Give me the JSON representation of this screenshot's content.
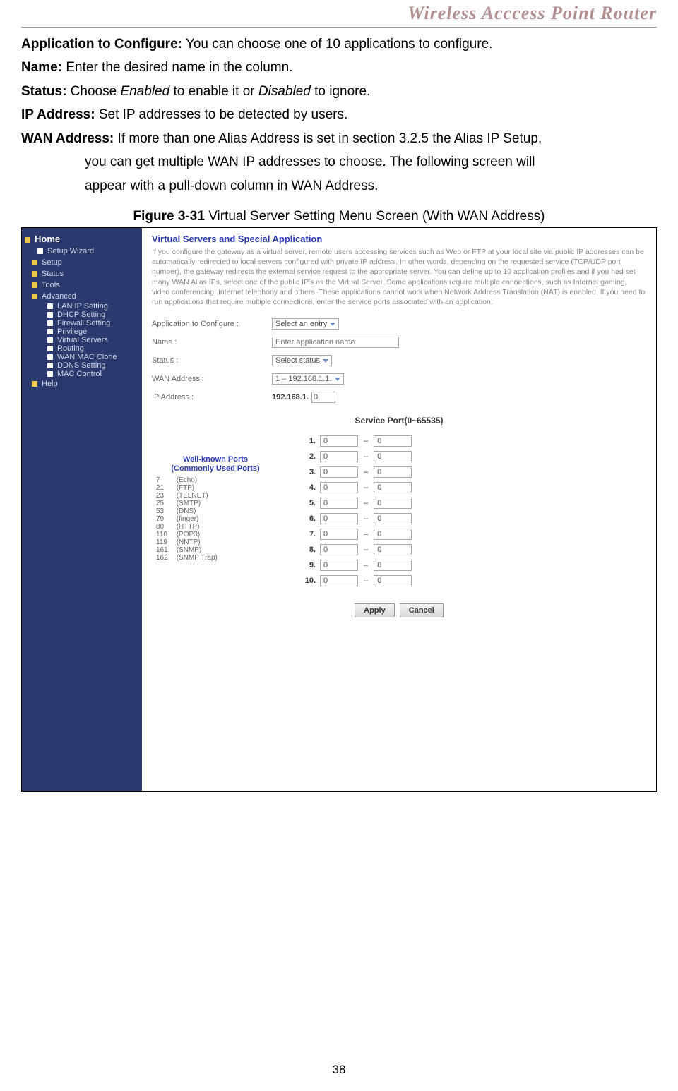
{
  "header": {
    "title": "Wireless  Acccess  Point  Router"
  },
  "text": {
    "app_label": "Application to Configure:",
    "app_text": " You can choose one of 10 applications to configure.",
    "name_label": "Name:",
    "name_text": " Enter the desired name in the column.",
    "status_label": "Status:",
    "status_text_a": " Choose ",
    "status_en": "Enabled",
    "status_text_b": " to enable it or ",
    "status_dis": "Disabled",
    "status_text_c": " to ignore.",
    "ip_label": "IP Address:",
    "ip_text": " Set IP addresses to be detected by users.",
    "wan_label": "WAN Address:",
    "wan_text_a": " If more than one Alias Address is set in section 3.2.5 the Alias IP Setup,",
    "wan_text_b": "you can get multiple WAN IP addresses to choose. The following screen will",
    "wan_text_c": "appear with a pull-down column in WAN Address."
  },
  "figure": {
    "caption_b": "Figure 3-31",
    "caption_t": " Virtual Server Setting Menu Screen (With WAN Address)"
  },
  "nav": {
    "home": "Home",
    "setup_wizard": "Setup Wizard",
    "setup": "Setup",
    "status": "Status",
    "tools": "Tools",
    "advanced": "Advanced",
    "lan": "LAN IP Setting",
    "dhcp": "DHCP Setting",
    "firewall": "Firewall Setting",
    "privilege": "Privilege",
    "vservers": "Virtual Servers",
    "routing": "Routing",
    "wanmac": "WAN MAC Clone",
    "ddns": "DDNS Setting",
    "maccontrol": "MAC Control",
    "help": "Help"
  },
  "panel": {
    "title": "Virtual Servers and Special Application",
    "desc": "If you configure the gateway as a virtual server, remote users accessing services such as Web or FTP at your local site via public IP addresses can be automatically redirected to local servers configured with private IP address. In other words, depending on the requested service (TCP/UDP port number), the gateway redirects the external service request to the appropriate server.\nYou can define up to 10 application profiles and if you had set many WAN Alias IPs, select one of the public IP's as the Virtual Server. Some applications require multiple connections, such as Internet gaming, video conferencing, Internet telephony and others. These applications cannot work when Network Address Translation (NAT) is enabled. If you need to run applications that require multiple connections, enter the service ports associated with an application.",
    "f_app_label": "Application to Configure :",
    "f_app_value": "Select an entry",
    "f_name_label": "Name :",
    "f_name_placeholder": "Enter application name",
    "f_status_label": "Status :",
    "f_status_value": "Select status",
    "f_wan_label": "WAN Address :",
    "f_wan_value": "1 – 192.168.1.1.",
    "f_ip_label": "IP Address :",
    "f_ip_prefix": "192.168.1.",
    "f_ip_value": "0",
    "sp_title": "Service Port(0~65535)",
    "wk_title1": "Well-known Ports",
    "wk_title2": "(Commonly Used Ports)",
    "wk_ports": [
      {
        "p": "7",
        "n": "(Echo)"
      },
      {
        "p": "21",
        "n": "(FTP)"
      },
      {
        "p": "23",
        "n": "(TELNET)"
      },
      {
        "p": "25",
        "n": "(SMTP)"
      },
      {
        "p": "53",
        "n": "(DNS)"
      },
      {
        "p": "79",
        "n": "(finger)"
      },
      {
        "p": "80",
        "n": "(HTTP)"
      },
      {
        "p": "110",
        "n": "(POP3)"
      },
      {
        "p": "119",
        "n": "(NNTP)"
      },
      {
        "p": "161",
        "n": "(SNMP)"
      },
      {
        "p": "162",
        "n": "(SNMP Trap)"
      }
    ],
    "ports": [
      {
        "n": "1.",
        "a": "0",
        "b": "0"
      },
      {
        "n": "2.",
        "a": "0",
        "b": "0"
      },
      {
        "n": "3.",
        "a": "0",
        "b": "0"
      },
      {
        "n": "4.",
        "a": "0",
        "b": "0"
      },
      {
        "n": "5.",
        "a": "0",
        "b": "0"
      },
      {
        "n": "6.",
        "a": "0",
        "b": "0"
      },
      {
        "n": "7.",
        "a": "0",
        "b": "0"
      },
      {
        "n": "8.",
        "a": "0",
        "b": "0"
      },
      {
        "n": "9.",
        "a": "0",
        "b": "0"
      },
      {
        "n": "10.",
        "a": "0",
        "b": "0"
      }
    ],
    "apply": "Apply",
    "cancel": "Cancel"
  },
  "page_number": "38"
}
